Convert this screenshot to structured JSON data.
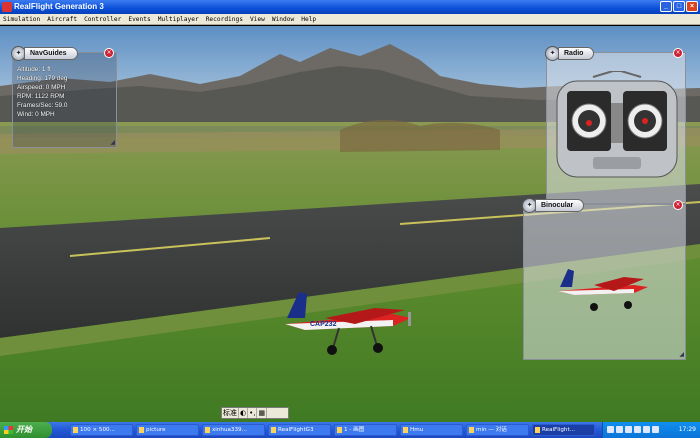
{
  "window": {
    "title": "RealFlight Generation 3",
    "buttons": [
      "_",
      "□",
      "×"
    ]
  },
  "menu": [
    "Simulation",
    "Aircraft",
    "Controller",
    "Events",
    "Multiplayer",
    "Recordings",
    "View",
    "Window",
    "Help"
  ],
  "panels": {
    "navguides": {
      "title": "NavGuides",
      "lines": [
        "Altitude: 1 ft",
        "Heading: 179 deg",
        "Airspeed: 0 MPH",
        "RPM: 1122 RPM",
        "Frames/Sec: 59.0",
        "Wind: 0 MPH"
      ]
    },
    "radio": {
      "title": "Radio"
    },
    "binocular": {
      "title": "Binocular"
    }
  },
  "aircraft": {
    "registration": "CAP232"
  },
  "ime_bar": [
    "标准",
    "◐",
    "•,",
    "▦"
  ],
  "taskbar": {
    "start": "开始",
    "items": [
      "100 × 500...",
      "picture",
      "xinhua339...",
      "RealFlightG3",
      "1 - 画图",
      "Hmu",
      "min — 对话",
      "RealFlight..."
    ],
    "clock": "17:29"
  },
  "colors": {
    "titlebar": "#0a4fd8",
    "taskbar": "#2458d6",
    "start": "#2f8f2f"
  }
}
